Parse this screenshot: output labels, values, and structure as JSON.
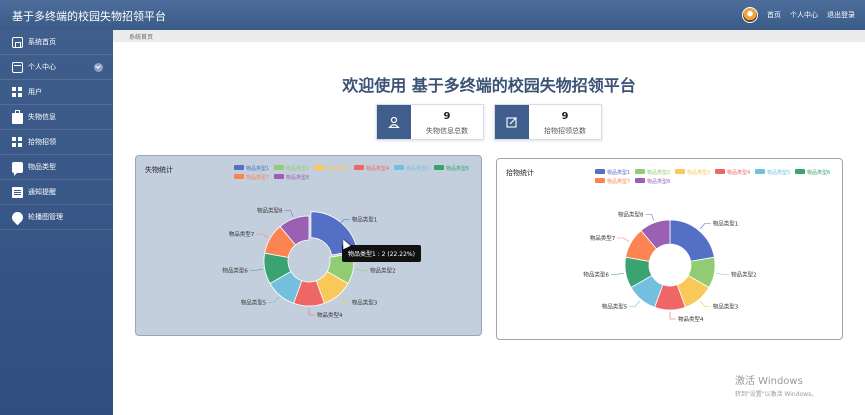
{
  "app": {
    "title": "基于多终端的校园失物招领平台"
  },
  "header": {
    "links": [
      "首页",
      "个人中心",
      "退出登录"
    ]
  },
  "sidebar": {
    "items": [
      {
        "label": "系统首页",
        "icon": "home-icon"
      },
      {
        "label": "个人中心",
        "icon": "card-icon",
        "expandable": true
      },
      {
        "label": "用户",
        "icon": "grid-icon"
      },
      {
        "label": "失物信息",
        "icon": "bag-icon"
      },
      {
        "label": "拾物招领",
        "icon": "grid-icon"
      },
      {
        "label": "物品类型",
        "icon": "chat-icon"
      },
      {
        "label": "通知提醒",
        "icon": "clipboard-icon"
      },
      {
        "label": "轮播图管理",
        "icon": "pin-icon"
      }
    ]
  },
  "breadcrumb": "系统首页",
  "welcome": "欢迎使用 基于多终端的校园失物招领平台",
  "stats": [
    {
      "value": "9",
      "label": "失物信息总数"
    },
    {
      "value": "9",
      "label": "拾物招领总数"
    }
  ],
  "tooltip": "物品类型1 : 2 (22.22%)",
  "windows_activation": {
    "line1": "激活 Windows",
    "line2": "转到\"设置\"以激活 Windows。"
  },
  "colors": {
    "accent": "#3f5e8c",
    "series": [
      "#5470c6",
      "#91cc75",
      "#fac858",
      "#ee6666",
      "#73c0de",
      "#3ba272",
      "#fc8452",
      "#9a60b4"
    ]
  },
  "chart_data": [
    {
      "type": "pie",
      "title": "失物统计",
      "legend_position": "top",
      "categories": [
        "物品类型1",
        "物品类型2",
        "物品类型3",
        "物品类型4",
        "物品类型5",
        "物品类型6",
        "物品类型7",
        "物品类型8"
      ],
      "values": [
        2,
        1,
        1,
        1,
        1,
        1,
        1,
        1
      ]
    },
    {
      "type": "pie",
      "title": "拾物统计",
      "legend_position": "top",
      "categories": [
        "物品类型1",
        "物品类型2",
        "物品类型3",
        "物品类型4",
        "物品类型5",
        "物品类型6",
        "物品类型7",
        "物品类型8"
      ],
      "values": [
        2,
        1,
        1,
        1,
        1,
        1,
        1,
        1
      ]
    }
  ]
}
